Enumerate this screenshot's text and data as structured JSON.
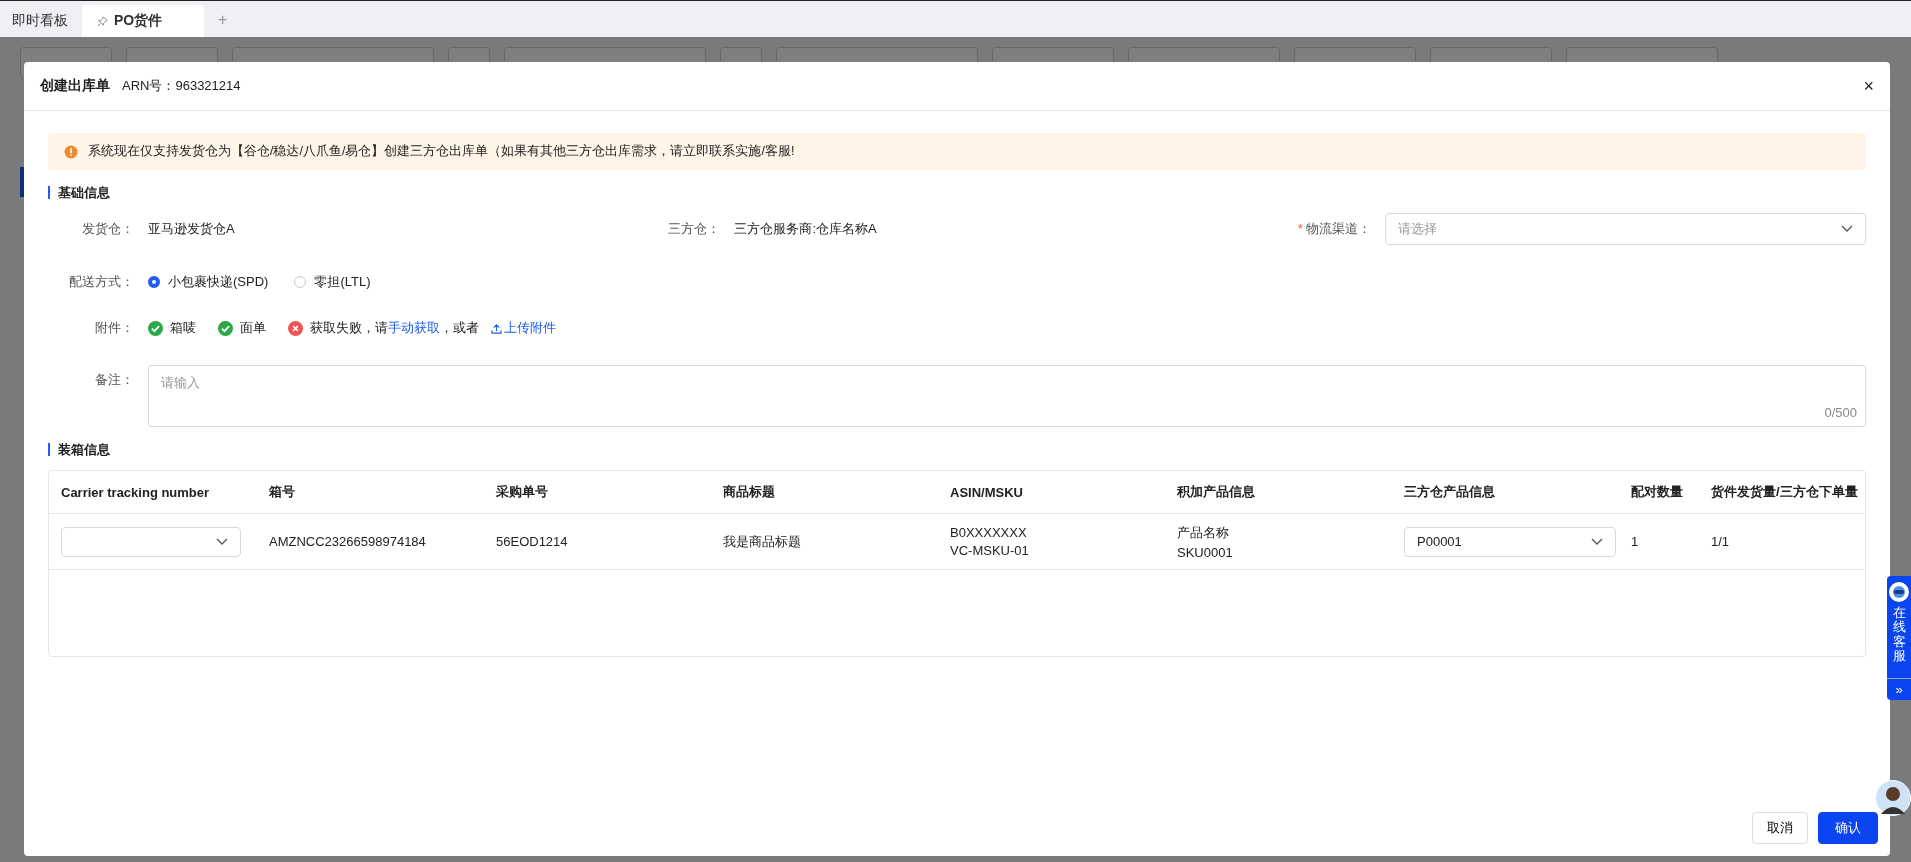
{
  "tabs": [
    {
      "label": "即时看板",
      "selected": false,
      "pinned": false
    },
    {
      "label": "PO货件",
      "selected": true,
      "pinned": true
    }
  ],
  "add_tab": "+",
  "modal": {
    "title": "创建出库单",
    "subtitle": "ARN号：963321214",
    "close": "×"
  },
  "alert": "系统现在仅支持发货仓为【谷仓/稳达/八爪鱼/易仓】创建三方仓出库单（如果有其他三方仓出库需求，请立即联系实施/客服!",
  "basic_info": {
    "title": "基础信息",
    "ship_from": {
      "label": "发货仓：",
      "value": "亚马逊发货仓A"
    },
    "third_party": {
      "label": "三方仓：",
      "value": "三方仓服务商:仓库名称A"
    },
    "channel": {
      "label": "物流渠道：",
      "required_mark": "*",
      "placeholder": "请选择"
    },
    "delivery": {
      "label": "配送方式：",
      "options": [
        {
          "label": "小包裹快递(SPD)",
          "selected": true
        },
        {
          "label": "零担(LTL)",
          "selected": false
        }
      ]
    },
    "attachments": {
      "label": "附件：",
      "items": [
        {
          "kind": "ok",
          "label": "箱唛"
        },
        {
          "kind": "ok",
          "label": "面单"
        },
        {
          "kind": "error",
          "label": "获取失败，请",
          "link": "手动获取",
          "after": "，或者"
        }
      ],
      "upload_link": "上传附件"
    },
    "remarks": {
      "label": "备注：",
      "placeholder": "请输入",
      "counter": "0/500"
    }
  },
  "packing": {
    "title": "装箱信息",
    "columns": [
      "Carrier tracking number",
      "箱号",
      "采购单号",
      "商品标题",
      "ASIN/MSKU",
      "积加产品信息",
      "三方仓产品信息",
      "配对数量",
      "货件发货量/三方仓下单量"
    ],
    "rows": [
      {
        "box_no": "AMZNCC23266598974184",
        "po": "56EOD1214",
        "title": "我是商品标题",
        "asin": "B0XXXXXXX",
        "msku": "VC-MSKU-01",
        "product_name": "产品名称",
        "sku": "SKU0001",
        "tp_product": "P00001",
        "qty": "1",
        "ratio": "1/1"
      }
    ]
  },
  "buttons": {
    "cancel": "取消",
    "confirm": "确认"
  },
  "chat": {
    "label": "在线客服",
    "expand": "»"
  }
}
